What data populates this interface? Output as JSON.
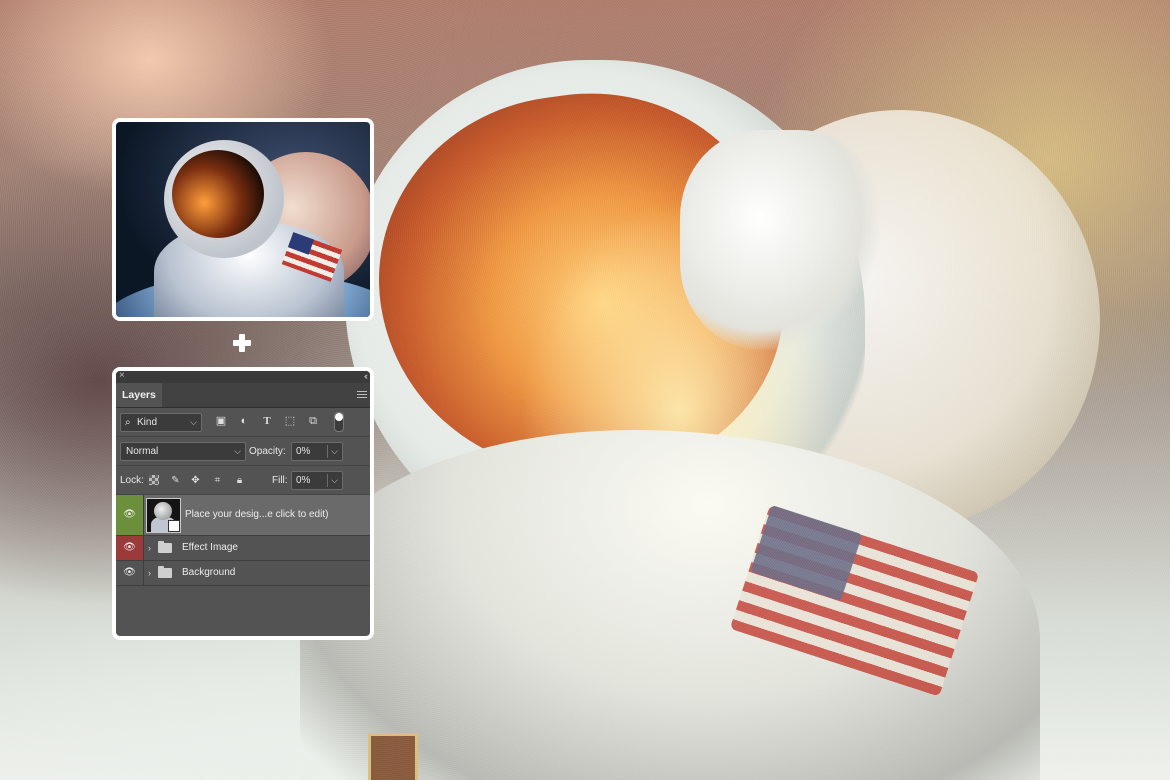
{
  "layers_panel": {
    "tab_label": "Layers",
    "close_glyph": "×",
    "collapse_glyph": "‹‹",
    "filter": {
      "kind_label": "Kind",
      "search_glyph": "🔍",
      "toggle_state": "on"
    },
    "blend_mode": "Normal",
    "opacity_label": "Opacity:",
    "opacity_value": "0%",
    "lock_label": "Lock:",
    "fill_label": "Fill:",
    "fill_value": "0%",
    "layers": [
      {
        "name": "Place your desig...e click to edit)",
        "visible": true,
        "type": "smart-object",
        "eye_color": "#6b8f3b"
      },
      {
        "name": "Effect Image",
        "visible": true,
        "type": "group",
        "eye_color": "#9a3a3a"
      },
      {
        "name": "Background",
        "visible": true,
        "type": "group"
      }
    ]
  },
  "icons": {
    "filter_icons": [
      "image-icon",
      "adjustment-icon",
      "type-icon",
      "shape-icon",
      "smart-object-icon"
    ],
    "lock_icons": [
      "lock-transparent-icon",
      "lock-brush-icon",
      "lock-move-icon",
      "lock-artboard-icon",
      "lock-all-icon"
    ]
  },
  "colors": {
    "panel_bg": "#535353",
    "selected_layer_bg": "#6a6a6a",
    "frame_border": "#ffffff"
  }
}
